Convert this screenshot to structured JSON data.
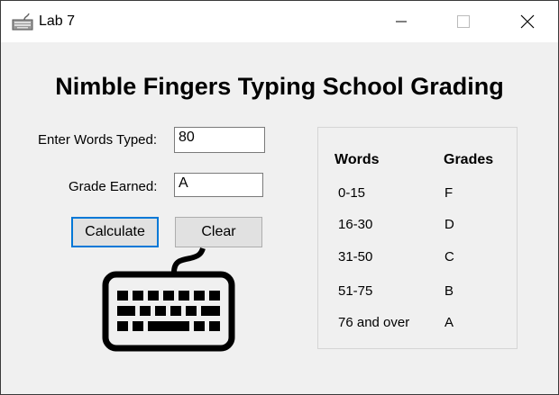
{
  "window": {
    "title": "Lab 7"
  },
  "heading": "Nimble Fingers Typing School Grading",
  "form": {
    "words_label": "Enter Words Typed:",
    "words_value": "80",
    "grade_label": "Grade Earned:",
    "grade_value": "A",
    "calculate_label": "Calculate",
    "clear_label": "Clear"
  },
  "table": {
    "headers": [
      "Words",
      "Grades"
    ],
    "rows": [
      [
        "0-15",
        "F"
      ],
      [
        "16-30",
        "D"
      ],
      [
        "31-50",
        "C"
      ],
      [
        "51-75",
        "B"
      ],
      [
        "76 and over",
        "A"
      ]
    ]
  }
}
